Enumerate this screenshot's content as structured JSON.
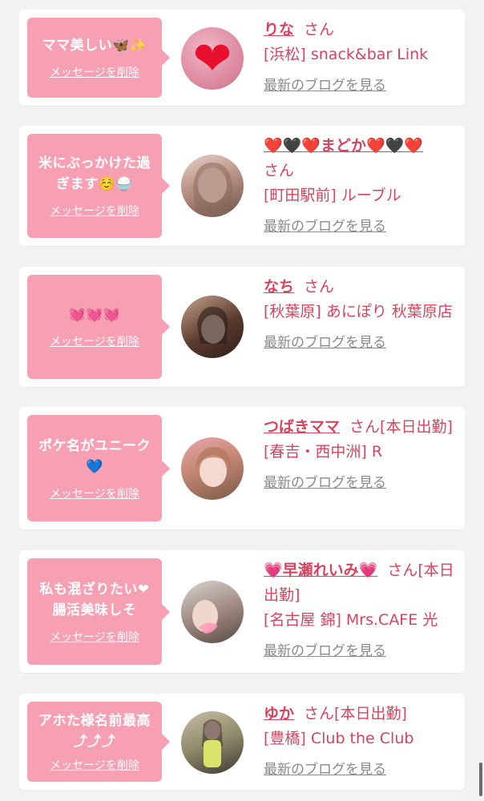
{
  "delete_label": "メッセージを削除",
  "blog_label": "最新のブログを見る",
  "san_label": "さん",
  "cards": [
    {
      "message": "ママ美しい🦋✨",
      "name": "りな",
      "suffix": "",
      "shop": "[浜松] snack&bar Link",
      "avatar_icon": "heart-avatar"
    },
    {
      "message": "米にぶっかけた過\nぎます☺️🍚",
      "name": "❤️🖤❤️まどか❤️🖤❤️",
      "suffix": "",
      "shop": "[町田駅前] ルーブル",
      "avatar_icon": "person-avatar"
    },
    {
      "message": "💓💓💓",
      "name": "なち",
      "suffix": "",
      "shop": "[秋葉原] あにぽり 秋葉原店",
      "avatar_icon": "person-avatar"
    },
    {
      "message": "ポケ名がユニーク\n💙",
      "name": "つばきママ",
      "suffix": "[本日出勤]",
      "shop": "[春吉・西中洲] R",
      "avatar_icon": "person-avatar"
    },
    {
      "message": "私も混ざりたい❤\n腸活美味しそ",
      "name": "💗早瀬れいみ💗",
      "suffix": "[本日出勤]",
      "shop": "[名古屋 錦] Mrs.CAFE 光",
      "avatar_icon": "person-avatar"
    },
    {
      "message": "アホた様名前最高\n⤴︎⤴︎⤴︎",
      "name": "ゆか",
      "suffix": "[本日出勤]",
      "shop": "[豊橋] Club the Club",
      "avatar_icon": "person-avatar"
    }
  ]
}
